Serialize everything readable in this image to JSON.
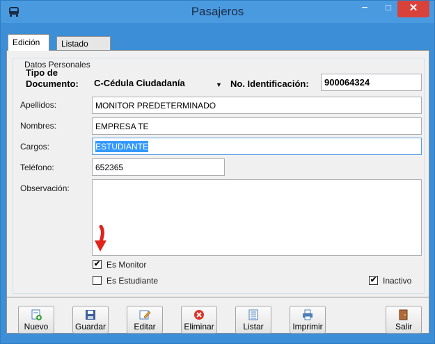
{
  "window": {
    "title": "Pasajeros",
    "minimize": "−",
    "maximize": "□",
    "close": "✕"
  },
  "tabs": [
    {
      "label": "Edición",
      "active": true
    },
    {
      "label": "Listado",
      "active": false
    }
  ],
  "form": {
    "group_title": "Datos Personales",
    "tipo_documento": {
      "label_line1": "Tipo de",
      "label_line2": "Documento:",
      "value": "C-Cédula Ciudadanía"
    },
    "no_identificacion": {
      "label": "No. Identificación:",
      "value": "900064324"
    },
    "apellidos": {
      "label": "Apellidos:",
      "value": "MONITOR PREDETERMINADO"
    },
    "nombres": {
      "label": "Nombres:",
      "value": "EMPRESA TE"
    },
    "cargos": {
      "label": "Cargos:",
      "value": "ESTUDIANTE"
    },
    "telefono": {
      "label": "Teléfono:",
      "value": "652365"
    },
    "observacion": {
      "label": "Observación:",
      "value": ""
    },
    "es_monitor": {
      "label": "Es Monitor",
      "checked": true
    },
    "es_estudiante": {
      "label": "Es Estudiante",
      "checked": false
    },
    "inactivo": {
      "label": "Inactivo",
      "checked": true
    }
  },
  "toolbar": {
    "nuevo": "Nuevo",
    "guardar": "Guardar",
    "editar": "Editar",
    "eliminar": "Eliminar",
    "listar": "Listar",
    "imprimir": "Imprimir",
    "salir": "Salir"
  },
  "icons": {
    "app": "bus-icon",
    "nuevo": "new-document-icon",
    "guardar": "save-icon",
    "editar": "edit-icon",
    "eliminar": "delete-icon",
    "listar": "list-icon",
    "imprimir": "printer-icon",
    "salir": "exit-door-icon",
    "annotation": "red-arrow-icon"
  },
  "colors": {
    "titlebar": "#4a9ae0",
    "close": "#d9423a",
    "selection": "#3399ff",
    "arrow": "#e0241c"
  }
}
